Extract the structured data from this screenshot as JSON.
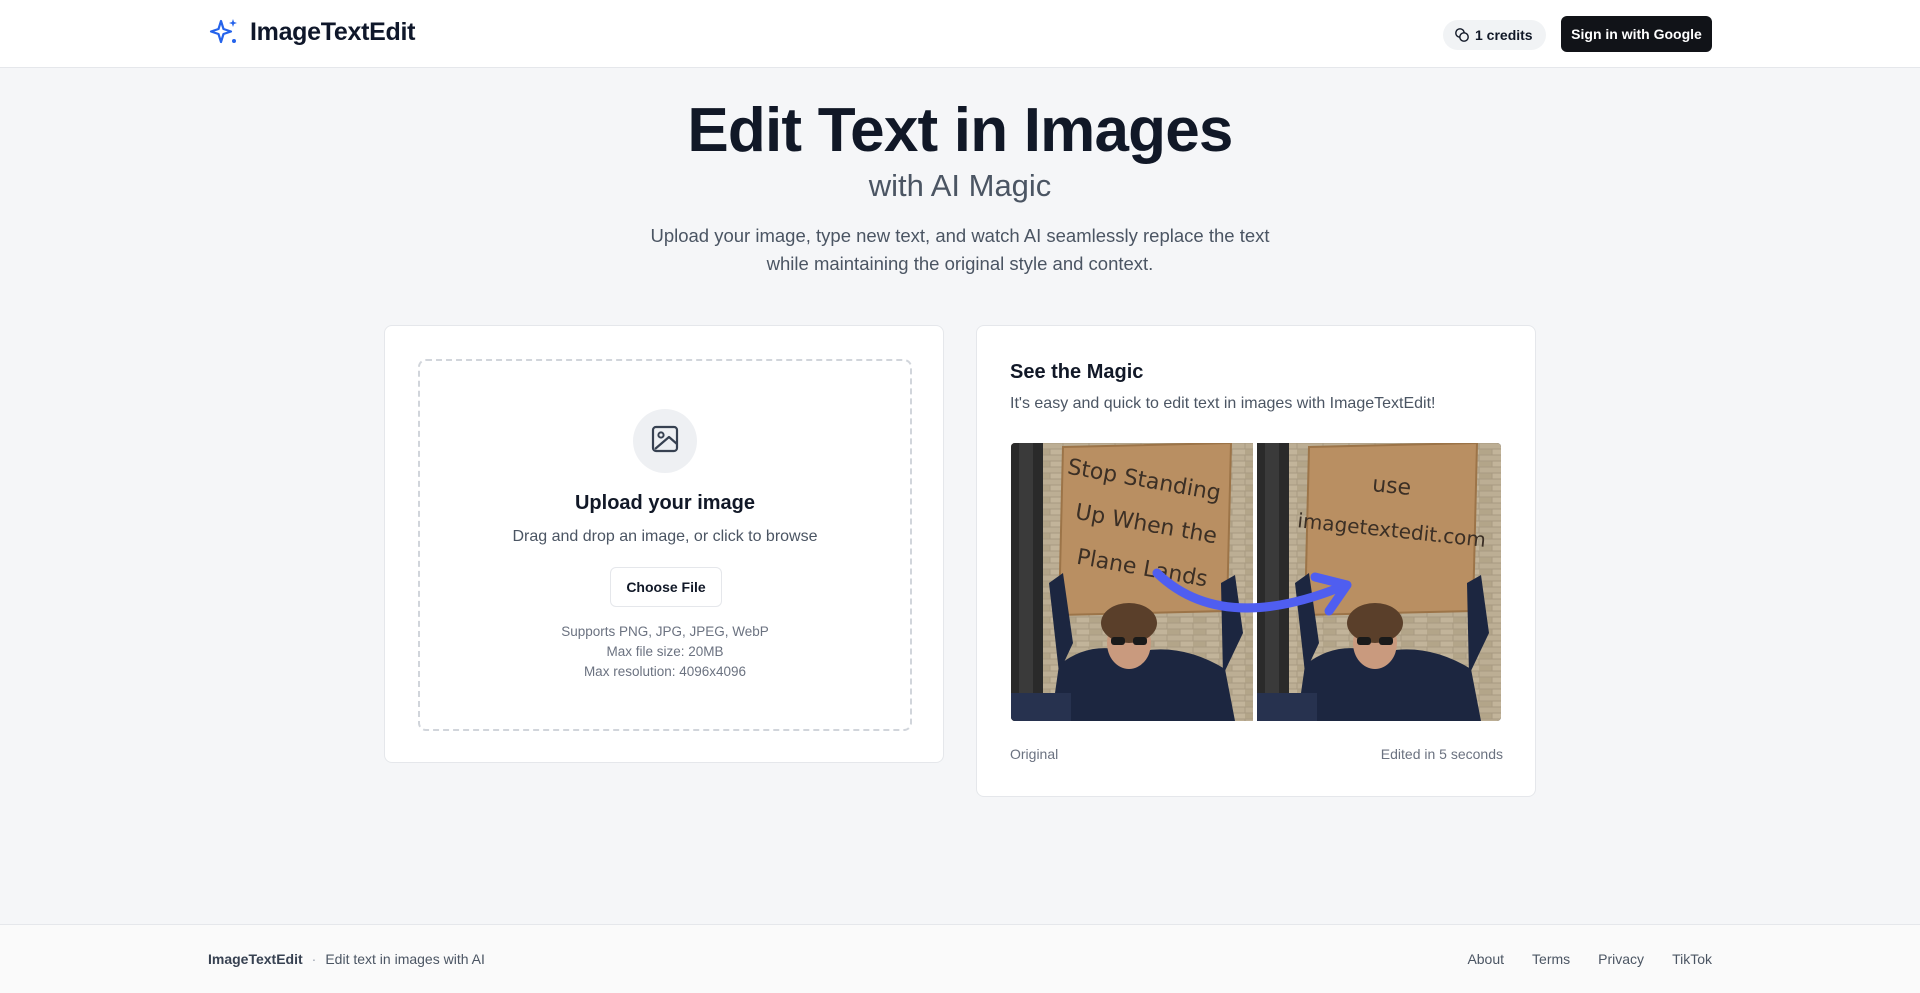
{
  "header": {
    "brand": "ImageTextEdit",
    "credits_label": "1 credits",
    "signin_label": "Sign in with Google"
  },
  "hero": {
    "title": "Edit Text in Images",
    "subtitle": "with AI Magic",
    "description_line1": "Upload your image, type new text, and watch AI seamlessly replace the text",
    "description_line2": "while maintaining the original style and context."
  },
  "upload": {
    "title": "Upload your image",
    "description": "Drag and drop an image, or click to browse",
    "button_label": "Choose File",
    "notes": [
      "Supports PNG, JPG, JPEG, WebP",
      "Max file size: 20MB",
      "Max resolution: 4096x4096"
    ]
  },
  "magic": {
    "title": "See the Magic",
    "description": "It's easy and quick to edit text in images with ImageTextEdit!",
    "sign_original": [
      "Stop Standing",
      "Up When the",
      "Plane Lands"
    ],
    "sign_edited": [
      "use",
      "imagetextedit.com"
    ],
    "label_original": "Original",
    "label_edited": "Edited in 5 seconds"
  },
  "footer": {
    "brand": "ImageTextEdit",
    "tagline": "Edit text in images with AI",
    "links": [
      "About",
      "Terms",
      "Privacy",
      "TikTok"
    ]
  },
  "colors": {
    "accent": "#2563eb",
    "arrow": "#4f5ef0",
    "button_dark": "#111318",
    "background": "#f5f6f8"
  }
}
